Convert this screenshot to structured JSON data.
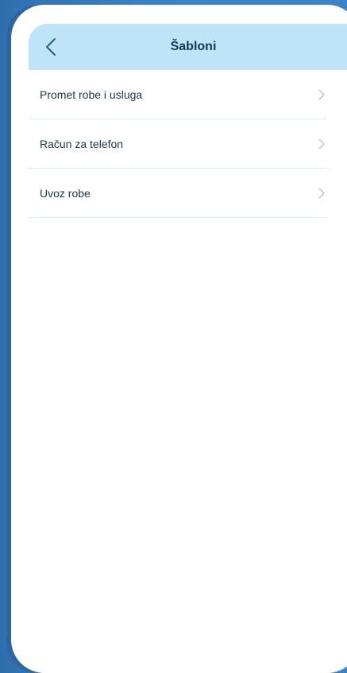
{
  "header": {
    "title": "Šabloni",
    "back_icon": "chevron-left-icon"
  },
  "templates": [
    {
      "label": "Promet robe i usluga",
      "icon": "chevron-right-icon"
    },
    {
      "label": "Račun za telefon",
      "icon": "chevron-right-icon"
    },
    {
      "label": "Uvoz robe",
      "icon": "chevron-right-icon"
    }
  ],
  "colors": {
    "header_bg": "#bfe3f7",
    "title_text": "#0d3a5c",
    "item_text": "#16384f",
    "divider": "#d8ebf6",
    "background": "#3a80c4"
  }
}
